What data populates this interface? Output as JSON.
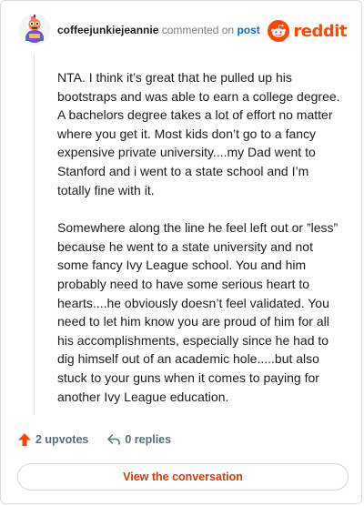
{
  "comment": {
    "username": "coffeejunkiejeannie",
    "verb": "commented on",
    "target_link": "post",
    "brand": "reddit",
    "paragraphs": [
      "NTA. I think it’s great that he pulled up his bootstraps and was able to earn a college degree. A bachelors degree takes a lot of effort no matter where you get it. Most kids don’t go to a fancy expensive private university....my Dad went to Stanford and i went to a state school and I’m totally fine with it.",
      "Somewhere along the line he feel left out or ”less” because he went to a state university and not some fancy Ivy League school. You and him probably need to have some serious heart to hearts....he obviously doesn’t feel validated. You need to let him know you are proud of him for all his accomplishments, especially since he had to dig himself out of an academic hole.....but also stuck to your guns when it comes to paying for another Ivy League education."
    ],
    "upvotes_label": "2 upvotes",
    "replies_label": "0 replies",
    "cta_label": "View the conversation"
  },
  "icons": {
    "avatar": "avatar-icon",
    "logo": "reddit-snoo-icon",
    "upvote": "upvote-arrow-icon",
    "reply": "reply-arrow-icon"
  },
  "colors": {
    "brand": "#ff4500",
    "upvote": "#ff4500",
    "link": "#0a6bd1",
    "cta": "#d93a00",
    "muted": "#576f76"
  }
}
